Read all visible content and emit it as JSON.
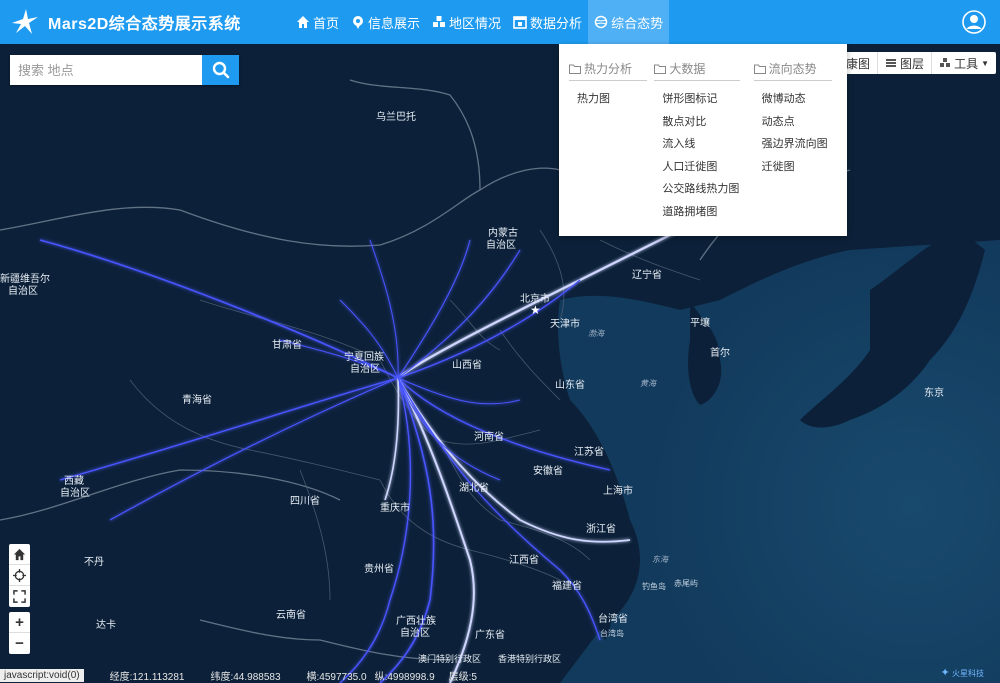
{
  "header": {
    "title": "Mars2D综合态势展示系统",
    "nav": [
      {
        "label": "首页",
        "icon": "home-icon"
      },
      {
        "label": "信息展示",
        "icon": "pin-icon"
      },
      {
        "label": "地区情况",
        "icon": "cubes-icon"
      },
      {
        "label": "数据分析",
        "icon": "calendar-icon"
      },
      {
        "label": "综合态势",
        "icon": "globe-icon",
        "active": true
      }
    ]
  },
  "search": {
    "placeholder": "搜索 地点"
  },
  "toolbar": {
    "items": [
      {
        "label": "底图",
        "partial": "康图"
      },
      {
        "label": "图层"
      },
      {
        "label": "工具"
      }
    ]
  },
  "dropdown": {
    "columns": [
      {
        "title": "热力分析",
        "items": [
          "热力图"
        ]
      },
      {
        "title": "大数据",
        "items": [
          "饼形图标记",
          "散点对比",
          "流入线",
          "人口迁徙图",
          "公交路线热力图",
          "道路拥堵图"
        ]
      },
      {
        "title": "流向态势",
        "items": [
          "微博动态",
          "动态点",
          "强边界流向图",
          "迁徙图"
        ]
      }
    ]
  },
  "map_labels": [
    {
      "text": "乌兰巴托"
    },
    {
      "text": "内蒙古"
    },
    {
      "text": "自治区"
    },
    {
      "text": "北京市"
    },
    {
      "text": "天津市"
    },
    {
      "text": "辽宁省"
    },
    {
      "text": "平壤"
    },
    {
      "text": "首尔"
    },
    {
      "text": "东京"
    },
    {
      "text": "渤海"
    },
    {
      "text": "黄海"
    },
    {
      "text": "甘肃省"
    },
    {
      "text": "宁夏回族"
    },
    {
      "text": "自治区"
    },
    {
      "text": "山西省"
    },
    {
      "text": "山东省"
    },
    {
      "text": "青海省"
    },
    {
      "text": "河南省"
    },
    {
      "text": "江苏省"
    },
    {
      "text": "安徽省"
    },
    {
      "text": "上海市"
    },
    {
      "text": "湖北省"
    },
    {
      "text": "西藏"
    },
    {
      "text": "自治区"
    },
    {
      "text": "四川省"
    },
    {
      "text": "重庆市"
    },
    {
      "text": "浙江省"
    },
    {
      "text": "东海"
    },
    {
      "text": "江西省"
    },
    {
      "text": "福建省"
    },
    {
      "text": "钓鱼岛"
    },
    {
      "text": "赤尾屿"
    },
    {
      "text": "贵州省"
    },
    {
      "text": "台湾省"
    },
    {
      "text": "台湾岛"
    },
    {
      "text": "云南省"
    },
    {
      "text": "广西壮族"
    },
    {
      "text": "自治区"
    },
    {
      "text": "广东省"
    },
    {
      "text": "澳门特别行政区"
    },
    {
      "text": "香港特别行政区"
    },
    {
      "text": "新疆维吾尔"
    },
    {
      "text": "自治区"
    },
    {
      "text": "不丹"
    },
    {
      "text": "达卡"
    }
  ],
  "status": {
    "link": "javascript:void(0)",
    "lng": "经度:121.113281",
    "lat": "纬度:44.988583",
    "x": "横:4597735.0",
    "y": "纵:4998998.9",
    "level": "层级:5"
  },
  "brand": "火星科技",
  "colors": {
    "header": "#1e9bf0",
    "map_bg": "#0c2139",
    "flow": "#4a55ff"
  }
}
